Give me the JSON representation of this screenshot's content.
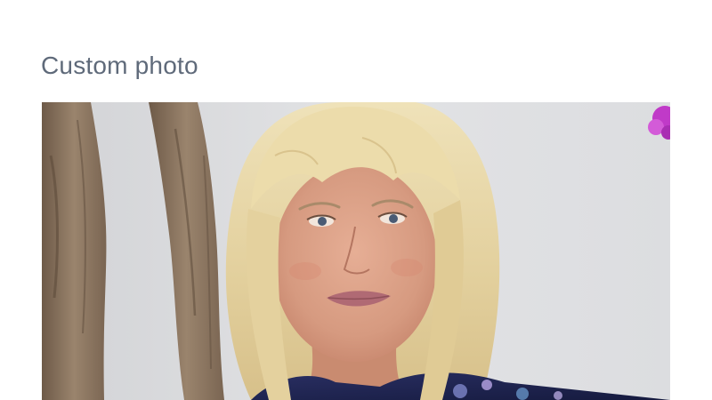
{
  "section": {
    "title": "Custom photo"
  },
  "photo": {
    "subject": "portrait-photo",
    "palette": {
      "wall": "#dcdde0",
      "bark": "#8b745f",
      "hair": "#e8d6a6",
      "skin": "#d89d84",
      "lips": "#b06a74",
      "dress": "#1e2350",
      "flower": "#c03ac8"
    }
  }
}
